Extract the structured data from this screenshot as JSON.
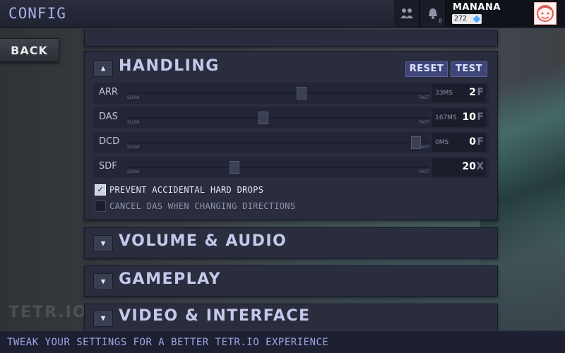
{
  "header": {
    "title": "CONFIG",
    "notifications_count": "0",
    "user": {
      "name": "MANANA",
      "rating": "272"
    }
  },
  "nav": {
    "back_label": "BACK"
  },
  "brand_watermark": "TETR.IO",
  "sections": {
    "handling": {
      "title": "HANDLING",
      "toggle": "▲",
      "reset_label": "RESET",
      "test_label": "TEST",
      "sliders": [
        {
          "label": "ARR",
          "slow": "SLOW",
          "fast": "FAST",
          "ms": "33MS",
          "value": "2",
          "unit": "F",
          "level": 0.58
        },
        {
          "label": "DAS",
          "slow": "SLOW",
          "fast": "FAST",
          "ms": "167MS",
          "value": "10",
          "unit": "F",
          "level": 0.45
        },
        {
          "label": "DCD",
          "slow": "SLOW",
          "fast": "FAST",
          "ms": "0MS",
          "value": "0",
          "unit": "F",
          "level": 0.97
        },
        {
          "label": "SDF",
          "slow": "SLOW",
          "fast": "FAST",
          "ms": "",
          "value": "20",
          "unit": "X",
          "level": 0.35
        }
      ],
      "checkboxes": [
        {
          "label": "PREVENT ACCIDENTAL HARD DROPS",
          "checked": true
        },
        {
          "label": "CANCEL DAS WHEN CHANGING DIRECTIONS",
          "checked": false
        }
      ]
    },
    "audio": {
      "title": "VOLUME & AUDIO",
      "toggle": "▼"
    },
    "gameplay": {
      "title": "GAMEPLAY",
      "toggle": "▼"
    },
    "video": {
      "title": "VIDEO & INTERFACE",
      "toggle": "▼"
    }
  },
  "footer": {
    "tip": "TWEAK YOUR SETTINGS FOR A BETTER TETR.IO EXPERIENCE"
  },
  "colors": {
    "accent": "#9ea6e6",
    "panel": "#2a2d3d",
    "button": "#3f4578"
  }
}
